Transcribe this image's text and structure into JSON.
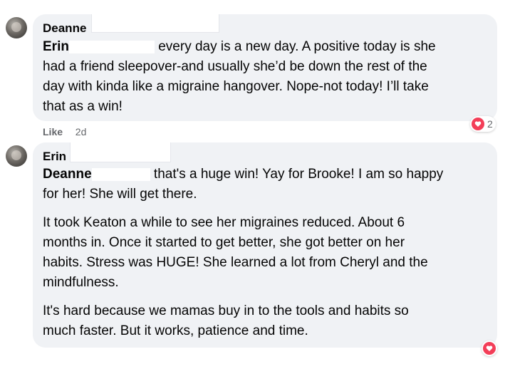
{
  "comment1": {
    "author": "Deanne",
    "mention": "Erin",
    "lines": [
      "every day is a new day. A positive today is she",
      "had a friend sleepover-and usually she’d be down the rest of the",
      "day with kinda like a migraine hangover. Nope-not today! I’ll take",
      "that as a win!"
    ],
    "like_label": "Like",
    "timestamp": "2d",
    "reaction_icon": "heart-icon",
    "reaction_count": "2"
  },
  "comment2": {
    "author": "Erin",
    "mention": "Deanne",
    "paragraph1": [
      "that's a huge win! Yay for Brooke! I am so happy",
      "for her! She will get there."
    ],
    "paragraph2": [
      "It took Keaton a while to see her migraines reduced. About 6",
      "months in. Once it started to get better, she got better on her",
      "habits. Stress was HUGE! She learned a lot from Cheryl and the",
      "mindfulness."
    ],
    "paragraph3": [
      "It's hard because we mamas buy in to the tools and habits so",
      "much faster. But it works, patience and time."
    ],
    "reaction_icon": "heart-icon"
  },
  "colors": {
    "bubble": "#f0f2f5",
    "text": "#050505",
    "meta": "#65676b",
    "heart": "#f33e58"
  }
}
